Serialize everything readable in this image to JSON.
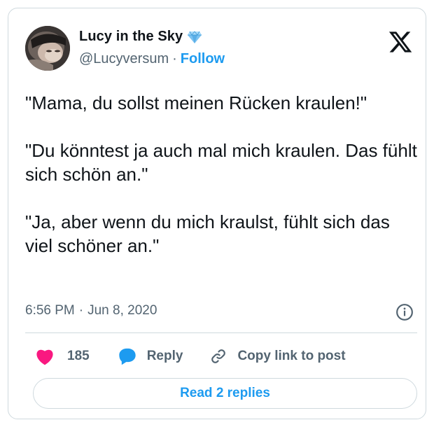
{
  "author": {
    "display_name": "Lucy in the Sky",
    "handle": "@Lucyversum",
    "separator": "·",
    "follow_label": "Follow",
    "verified_badge_icon": "diamond-icon"
  },
  "brand_icon": "x-logo-icon",
  "tweet": {
    "paragraphs": [
      "\"Mama, du sollst meinen Rücken kraulen!\"",
      "\"Du könntest ja auch mal mich kraulen. Das fühlt sich schön an.\"",
      "\"Ja, aber wenn du mich kraulst, fühlt sich das viel schöner an.\""
    ],
    "time": "6:56 PM",
    "date_separator": "·",
    "date": "Jun 8, 2020"
  },
  "actions": {
    "like_count": "185",
    "reply_label": "Reply",
    "copy_label": "Copy link to post"
  },
  "read_replies_label": "Read 2 replies",
  "colors": {
    "accent": "#1d9bf0",
    "like": "#f91880",
    "text": "#0f1419",
    "secondary": "#536471",
    "border": "#cfd9de"
  }
}
